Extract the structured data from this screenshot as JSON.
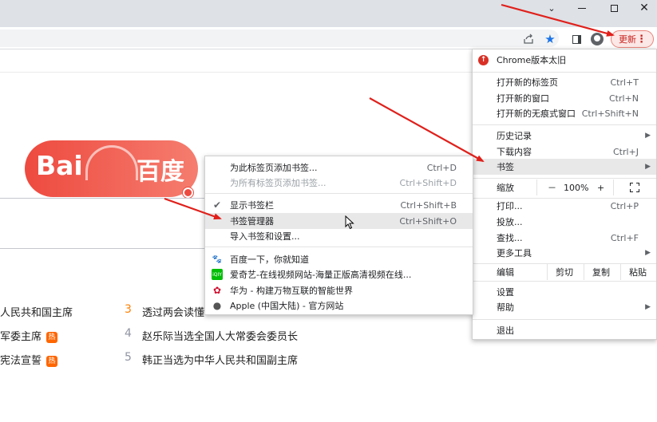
{
  "window_controls": {
    "tab_list": "⌄",
    "minimize": "",
    "maximize": "",
    "close": "✕"
  },
  "toolbar": {
    "update_label": "更新",
    "menu_dots": "⋮",
    "icons": [
      "share-icon",
      "bookmark-star-icon",
      "side-panel-icon",
      "profile-icon"
    ]
  },
  "baidu": {
    "logo_latin": "Bai",
    "logo_cn": "百度",
    "hot_list": [
      {
        "num": "",
        "text": "人民共和国主席",
        "badge": ""
      },
      {
        "num": "",
        "text": "军委主席",
        "badge": "热"
      },
      {
        "num": "",
        "text": "宪法宣誓",
        "badge": "热"
      },
      {
        "num": "3",
        "text": "透过两会读懂",
        "badge": ""
      },
      {
        "num": "4",
        "text": "赵乐际当选全国人大常委会委员长",
        "badge": ""
      },
      {
        "num": "5",
        "text": "韩正当选为中华人民共和国副主席",
        "badge": ""
      }
    ]
  },
  "main_menu": {
    "alert": "Chrome版本太旧",
    "new_tab": "打开新的标签页",
    "new_tab_sc": "Ctrl+T",
    "new_window": "打开新的窗口",
    "new_window_sc": "Ctrl+N",
    "incognito": "打开新的无痕式窗口",
    "incognito_sc": "Ctrl+Shift+N",
    "history": "历史记录",
    "downloads": "下载内容",
    "downloads_sc": "Ctrl+J",
    "bookmarks": "书签",
    "zoom_label": "缩放",
    "zoom_minus": "－",
    "zoom_value": "100%",
    "zoom_plus": "+",
    "print": "打印...",
    "print_sc": "Ctrl+P",
    "cast": "投放...",
    "find": "查找...",
    "find_sc": "Ctrl+F",
    "more_tools": "更多工具",
    "edit_label": "编辑",
    "cut": "剪切",
    "copy": "复制",
    "paste": "粘贴",
    "settings": "设置",
    "help": "帮助",
    "exit": "退出"
  },
  "bookmark_menu": {
    "add_page": "为此标签页添加书签...",
    "add_page_sc": "Ctrl+D",
    "add_all": "为所有标签页添加书签...",
    "add_all_sc": "Ctrl+Shift+D",
    "show_bar": "显示书签栏",
    "show_bar_sc": "Ctrl+Shift+B",
    "show_bar_checked": true,
    "manager": "书签管理器",
    "manager_sc": "Ctrl+Shift+O",
    "import": "导入书签和设置...",
    "bookmarks": [
      {
        "title": "百度一下，你就知道",
        "icon": "baidu-favicon"
      },
      {
        "title": "爱奇艺-在线视频网站-海量正版高清视频在线...",
        "icon": "iqiyi-favicon"
      },
      {
        "title": "华为 - 构建万物互联的智能世界",
        "icon": "huawei-favicon"
      },
      {
        "title": "Apple (中国大陆) - 官方网站",
        "icon": "apple-favicon"
      }
    ]
  },
  "colors": {
    "accent_red": "#d93025",
    "arrow_red": "#e0201b",
    "star_blue": "#1a73e8",
    "highlight": "#e8e8e9"
  }
}
